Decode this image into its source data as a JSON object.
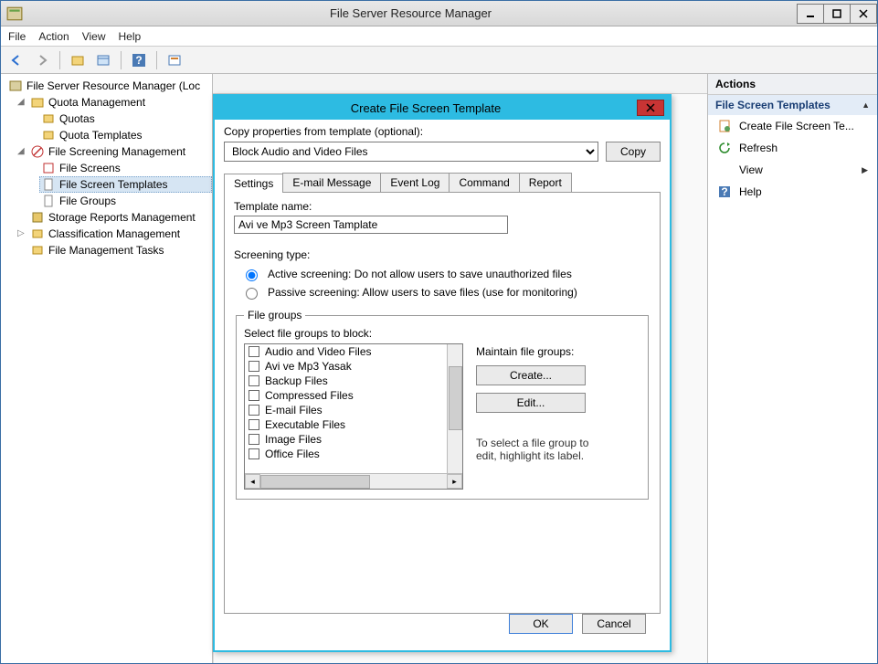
{
  "window": {
    "title": "File Server Resource Manager"
  },
  "menubar": [
    "File",
    "Action",
    "View",
    "Help"
  ],
  "tree": {
    "root": "File Server Resource Manager (Loc",
    "quota": {
      "label": "Quota Management",
      "children": [
        "Quotas",
        "Quota Templates"
      ]
    },
    "screening": {
      "label": "File Screening Management",
      "children": [
        "File Screens",
        "File Screen Templates",
        "File Groups"
      ]
    },
    "reports": "Storage Reports Management",
    "classification": "Classification Management",
    "mgmt_tasks": "File Management Tasks"
  },
  "actions": {
    "title": "Actions",
    "category": "File Screen Templates",
    "items": [
      {
        "label": "Create File Screen Te..."
      },
      {
        "label": "Refresh"
      },
      {
        "label": "View"
      },
      {
        "label": "Help"
      }
    ]
  },
  "dialog": {
    "title": "Create File Screen Template",
    "copy_label": "Copy properties from template (optional):",
    "copy_select": "Block Audio and Video Files",
    "copy_btn": "Copy",
    "tabs": [
      "Settings",
      "E-mail Message",
      "Event Log",
      "Command",
      "Report"
    ],
    "tmpl_name_label": "Template name:",
    "tmpl_name_value": "Avi ve Mp3 Screen Tamplate",
    "screen_type_label": "Screening type:",
    "active_label": "Active screening: Do not allow users to save unauthorized files",
    "passive_label": "Passive screening: Allow users to save files (use for monitoring)",
    "fg_legend": "File groups",
    "fg_select_label": "Select file groups to block:",
    "fg_items": [
      "Audio and Video Files",
      "Avi ve Mp3 Yasak",
      "Backup Files",
      "Compressed Files",
      "E-mail Files",
      "Executable Files",
      "Image Files",
      "Office Files"
    ],
    "maintain_label": "Maintain file groups:",
    "create_btn": "Create...",
    "edit_btn": "Edit...",
    "hint1": "To select a file group to",
    "hint2": "edit, highlight its label.",
    "ok": "OK",
    "cancel": "Cancel"
  }
}
